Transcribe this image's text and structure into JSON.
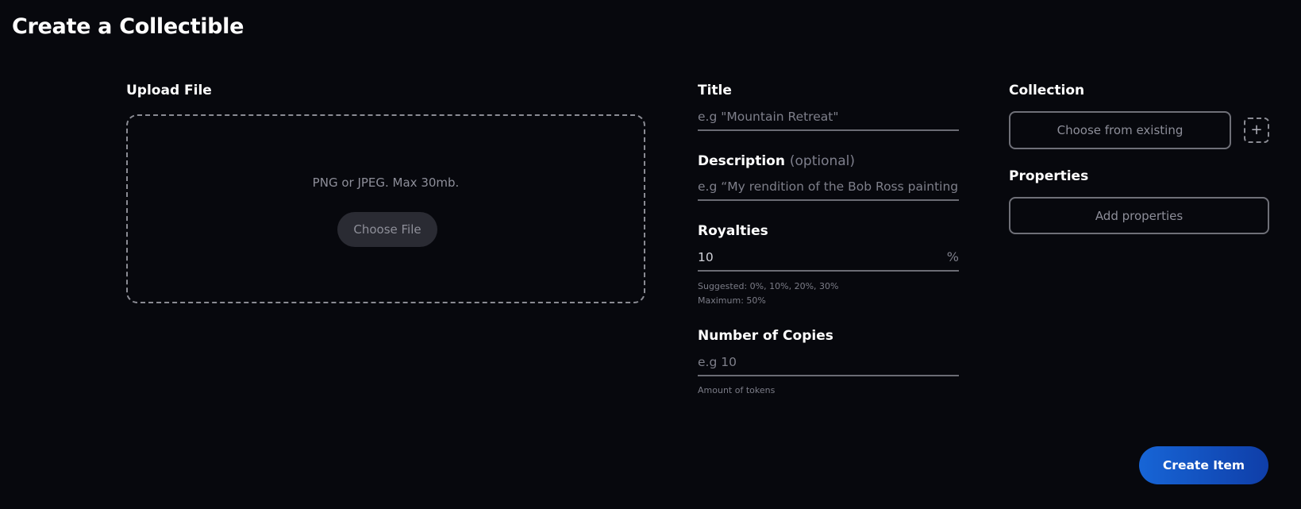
{
  "page": {
    "title": "Create a Collectible"
  },
  "upload": {
    "label": "Upload File",
    "hint": "PNG or JPEG. Max 30mb.",
    "button_label": "Choose File"
  },
  "title_field": {
    "label": "Title",
    "placeholder": "e.g \"Mountain Retreat\""
  },
  "description_field": {
    "label": "Description",
    "optional": "(optional)",
    "placeholder": "e.g “My rendition of the Bob Ross painting”"
  },
  "royalties_field": {
    "label": "Royalties",
    "value": "10",
    "suffix": "%",
    "suggested": "Suggested: 0%, 10%, 20%, 30%",
    "maximum": "Maximum: 50%"
  },
  "copies_field": {
    "label": "Number of Copies",
    "placeholder": "e.g 10",
    "hint": "Amount of tokens"
  },
  "collection": {
    "label": "Collection",
    "button_label": "Choose from existing",
    "add_icon": "+"
  },
  "properties": {
    "label": "Properties",
    "button_label": "Add properties"
  },
  "actions": {
    "create_label": "Create Item"
  },
  "colors": {
    "background": "#07080d",
    "accent": "#1765d6"
  }
}
